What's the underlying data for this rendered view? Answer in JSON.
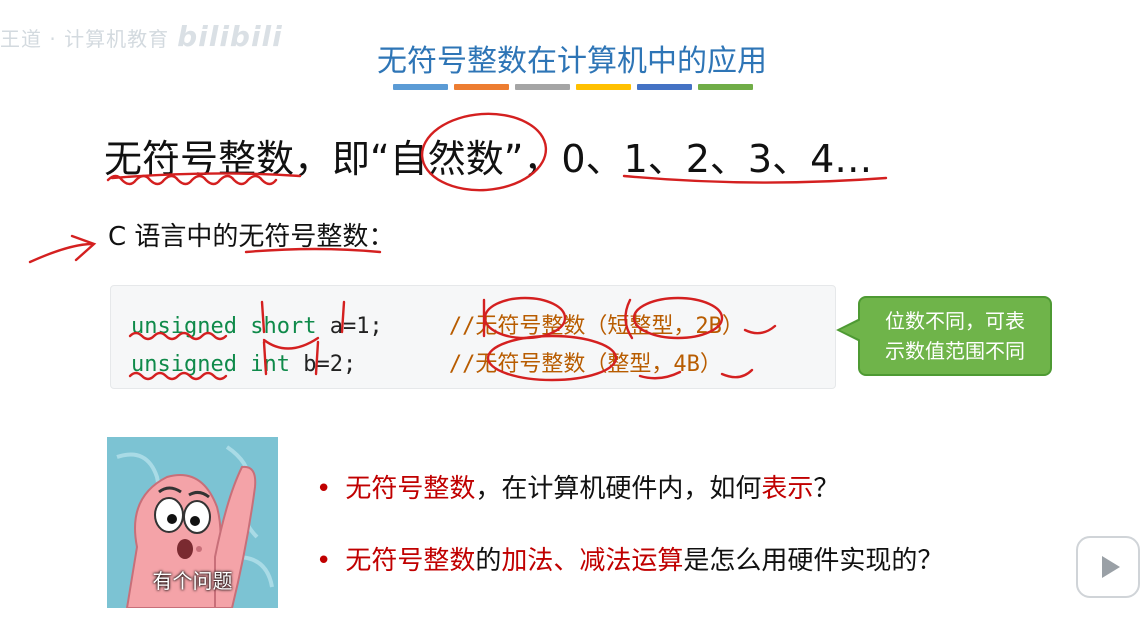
{
  "watermark": {
    "left_text": "王道 · 计算机教育",
    "brand": "bilibili"
  },
  "slide": {
    "title": "无符号整数在计算机中的应用",
    "headline": {
      "part1": "无符号整数，即“",
      "circled": "自然数",
      "part2": "”，",
      "numbers": "0、1、2、3、4…"
    },
    "subhead": {
      "prefix": "C 语言中的",
      "term": "无符号整数",
      "suffix": "："
    },
    "code": [
      {
        "kw": "unsigned",
        "type": "short",
        "rest": " a=1;",
        "comment": "//无符号整数（短整型，2B）"
      },
      {
        "kw": "unsigned",
        "type": "int",
        "rest": " b=2;",
        "comment": "//无符号整数（整型，4B）"
      }
    ],
    "callout": {
      "line1": "位数不同，可表",
      "line2": "示数值范围不同"
    },
    "meme_caption": "有个问题",
    "bullets": [
      {
        "r1": "无符号整数",
        "t1": "，在计算机硬件内，如何",
        "r2": "表示",
        "t2": "？"
      },
      {
        "r1": "无符号整数",
        "t1": "的",
        "r2": "加法、减法运算",
        "t2": "是怎么用硬件实现的？"
      }
    ]
  },
  "colors": {
    "title": "#2e75b6",
    "accent_red": "#c00000",
    "keyword_green": "#0f8a4a",
    "callout_green": "#6fb44a",
    "title_bars": [
      "#5b9bd5",
      "#ed7d31",
      "#a5a5a5",
      "#ffc000",
      "#4472c4",
      "#70ad47"
    ]
  },
  "icons": {
    "play": "play-icon"
  }
}
